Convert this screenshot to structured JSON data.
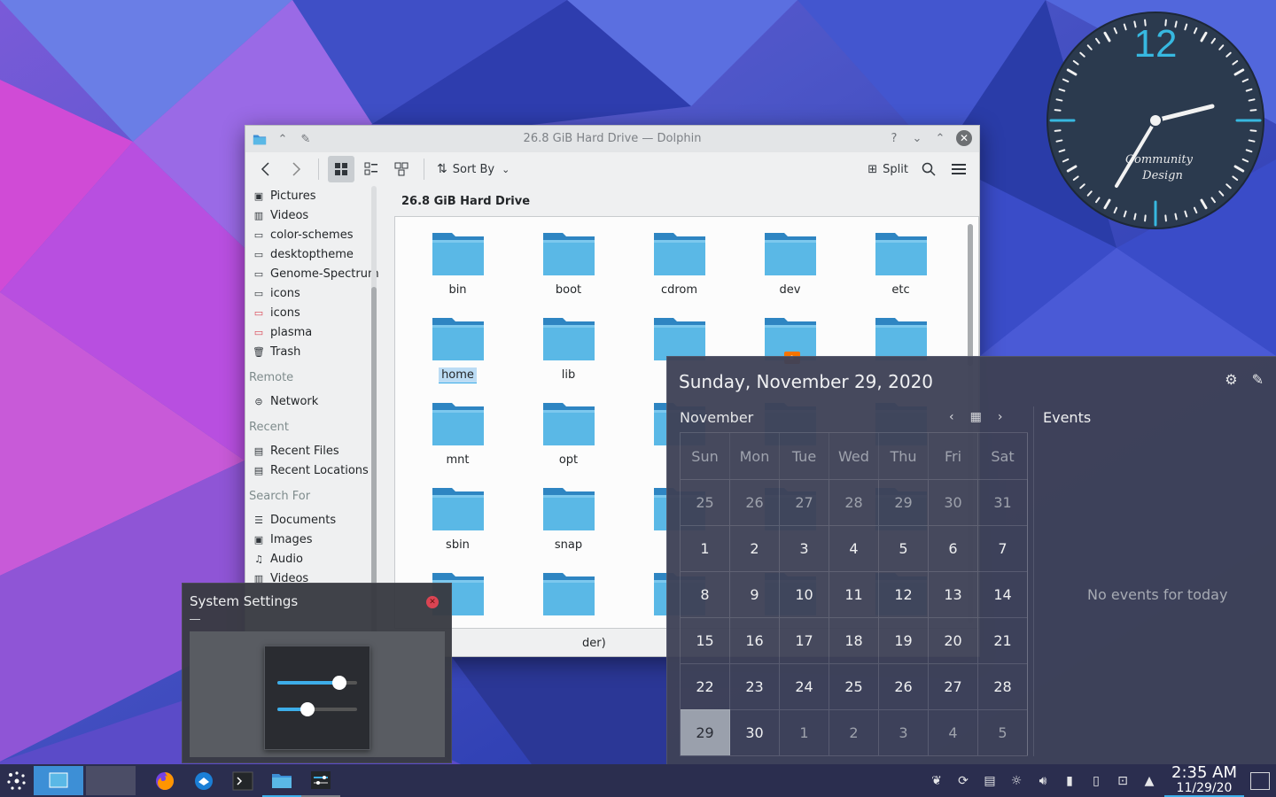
{
  "dolphin": {
    "title": "26.8 GiB Hard Drive — Dolphin",
    "toolbar": {
      "sort_label": "Sort By",
      "split_label": "Split"
    },
    "places": [
      {
        "label": "Pictures",
        "icon": "image-icon"
      },
      {
        "label": "Videos",
        "icon": "film-icon"
      },
      {
        "label": "color-schemes",
        "icon": "folder-icon"
      },
      {
        "label": "desktoptheme",
        "icon": "folder-icon"
      },
      {
        "label": "Genome-Spectrum",
        "icon": "folder-icon"
      },
      {
        "label": "icons",
        "icon": "folder-icon"
      },
      {
        "label": "icons",
        "icon": "folder-red-icon"
      },
      {
        "label": "plasma",
        "icon": "folder-red-icon"
      },
      {
        "label": "Trash",
        "icon": "trash-icon"
      }
    ],
    "sections": {
      "remote": "Remote",
      "network": "Network",
      "recent": "Recent",
      "recent_files": "Recent Files",
      "recent_locations": "Recent Locations",
      "search_for": "Search For",
      "documents": "Documents",
      "images": "Images",
      "audio": "Audio",
      "videos": "Videos"
    },
    "location": "26.8 GiB Hard Drive",
    "files": [
      "bin",
      "boot",
      "cdrom",
      "dev",
      "etc",
      "home",
      "lib",
      "",
      "",
      "",
      "mnt",
      "opt",
      "",
      "",
      "",
      "sbin",
      "snap",
      "",
      "",
      "",
      "",
      "",
      "",
      "",
      ""
    ],
    "status_fragment": "der)"
  },
  "system_settings": {
    "title": "System Settings"
  },
  "calendar": {
    "full_date": "Sunday, November 29, 2020",
    "month": "November",
    "weekdays": [
      "Sun",
      "Mon",
      "Tue",
      "Wed",
      "Thu",
      "Fri",
      "Sat"
    ],
    "days": [
      [
        "25",
        "26",
        "27",
        "28",
        "29",
        "30",
        "31"
      ],
      [
        "1",
        "2",
        "3",
        "4",
        "5",
        "6",
        "7"
      ],
      [
        "8",
        "9",
        "10",
        "11",
        "12",
        "13",
        "14"
      ],
      [
        "15",
        "16",
        "17",
        "18",
        "19",
        "20",
        "21"
      ],
      [
        "22",
        "23",
        "24",
        "25",
        "26",
        "27",
        "28"
      ],
      [
        "29",
        "30",
        "1",
        "2",
        "3",
        "4",
        "5"
      ]
    ],
    "events_title": "Events",
    "no_events": "No events for today"
  },
  "clock_widget": {
    "hour_numeral": "12",
    "brand_line1": "Community",
    "brand_line2": "Design"
  },
  "panel": {
    "time": "2:35 AM",
    "date": "11/29/20"
  },
  "colors": {
    "accent": "#3daee9",
    "folder": "#5ab8e6",
    "clock_face": "#2b3a4e",
    "clock_marks": "#37b8e0"
  }
}
